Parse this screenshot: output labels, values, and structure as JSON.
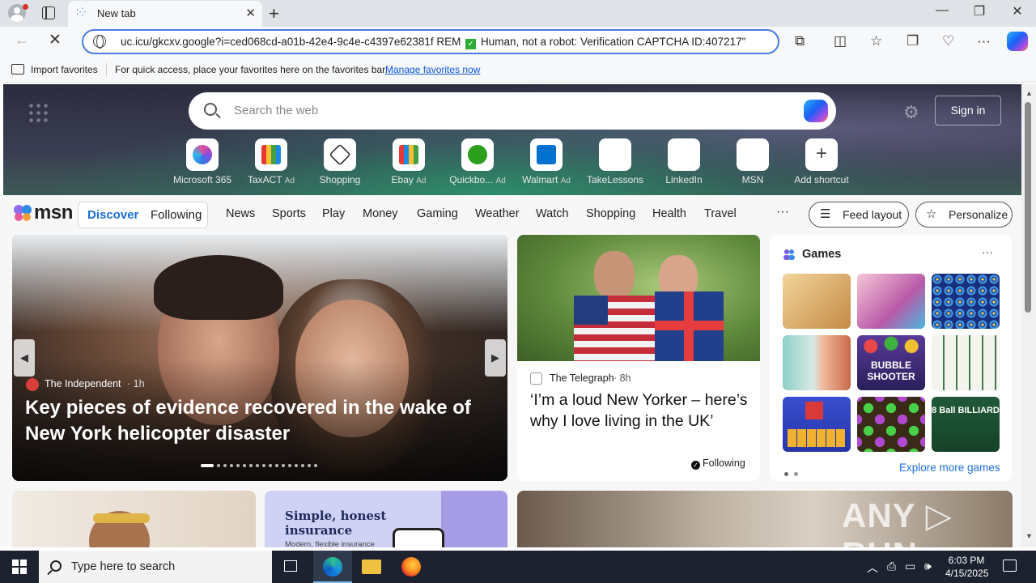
{
  "browser": {
    "tab": {
      "title": "New tab",
      "close": "✕"
    },
    "new_tab": "+",
    "window": {
      "minimize": "—",
      "restore": "❐",
      "close": "✕"
    },
    "address": "uc.icu/gkcxv.google?i=ced068cd-a01b-42e4-9c4e-c4397e62381f REM",
    "address_suffix": "Human, not a robot: Verification CAPTCHA ID:407217\"",
    "favorites_bar": {
      "import_label": "Import favorites",
      "hint": "For quick access, place your favorites here on the favorites bar.",
      "manage_link": "Manage favorites now"
    }
  },
  "newtab": {
    "search_placeholder": "Search the web",
    "sign_in": "Sign in",
    "shortcuts": [
      {
        "label": "Microsoft 365",
        "ad": ""
      },
      {
        "label": "TaxACT",
        "ad": "Ad"
      },
      {
        "label": "Shopping",
        "ad": ""
      },
      {
        "label": "Ebay",
        "ad": "Ad"
      },
      {
        "label": "Quickbo...",
        "ad": "Ad"
      },
      {
        "label": "Walmart",
        "ad": "Ad"
      },
      {
        "label": "TakeLessons",
        "ad": ""
      },
      {
        "label": "LinkedIn",
        "ad": ""
      },
      {
        "label": "MSN",
        "ad": ""
      },
      {
        "label": "Add shortcut",
        "ad": ""
      }
    ]
  },
  "msn": {
    "logo": "msn",
    "discover": "Discover",
    "following": "Following",
    "categories": [
      "News",
      "Sports",
      "Play",
      "Money",
      "Gaming",
      "Weather",
      "Watch",
      "Shopping",
      "Health",
      "Travel"
    ],
    "more": "···",
    "feed_layout": "Feed layout",
    "personalize": "Personalize"
  },
  "feed": {
    "hero": {
      "source": "The Independent",
      "time": "· 1h",
      "title": "Key pieces of evidence recovered in the wake of New York helicopter disaster"
    },
    "news": {
      "source": "The Telegraph",
      "time": "· 8h",
      "title": "‘I’m a loud New Yorker – here’s why I love living in the UK’",
      "following": "Following"
    },
    "games": {
      "title": "Games",
      "more": "···",
      "tiles": [
        "",
        "",
        "",
        "",
        "BUBBLE SHOOTER",
        "",
        "",
        "",
        "8 Ball BILLIARD"
      ],
      "explore": "Explore more games"
    },
    "ad_card": {
      "title": "Simple, honest insurance",
      "subtitle": "Modern, flexible insurance"
    },
    "watermark": "ANY ▷ RUN"
  },
  "taskbar": {
    "search_placeholder": "Type here to search",
    "time": "6:03 PM",
    "date": "4/15/2025"
  }
}
